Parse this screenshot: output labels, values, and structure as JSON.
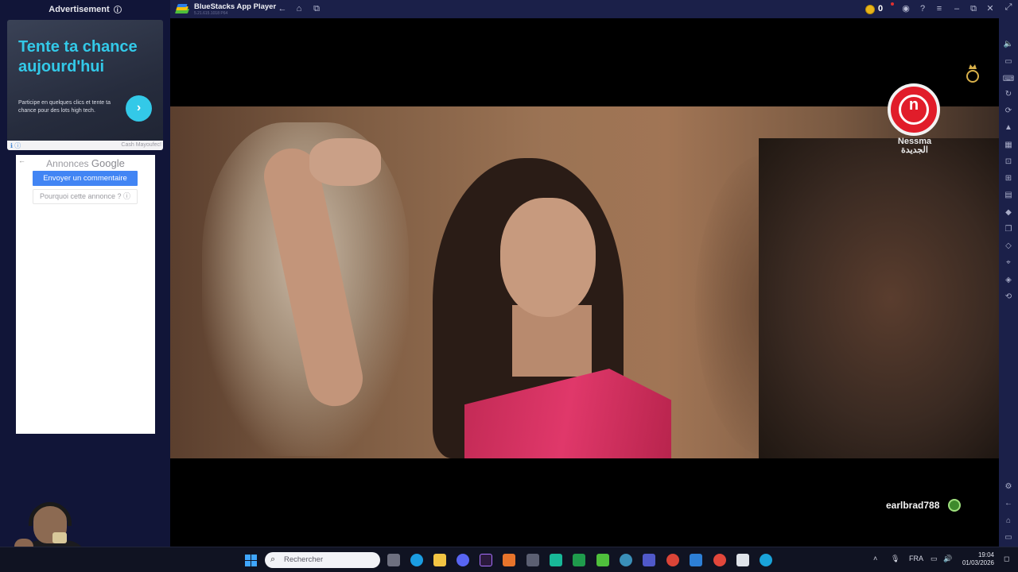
{
  "sidebar": {
    "ad_header": "Advertisement",
    "ad": {
      "title": "Tente ta chance aujourd'hui",
      "text": "Participe en quelques clics et tente ta chance pour des lots high tech.",
      "cta_icon": "›",
      "brand": "Cash Mayoufec!"
    },
    "google": {
      "annonces": "Annonces",
      "google_word": "Google",
      "feedback_button": "Envoyer un commentaire",
      "why_button": "Pourquoi cette annonce ?"
    }
  },
  "window": {
    "title": "BlueStacks App Player",
    "version": "5.21.615.1018 P64",
    "coins": "0",
    "icons": [
      "back-icon",
      "home-icon",
      "multi-instance-icon",
      "help-icon",
      "account-icon",
      "menu-icon",
      "minimize-icon",
      "restore-icon",
      "close-icon"
    ]
  },
  "video": {
    "channel_name": "Nessma الجديدة",
    "username": "earlbrad788"
  },
  "rightbar_icons": [
    "fullscreen-icon",
    "volume-icon",
    "media-icon",
    "keyboard-icon",
    "rotate-icon",
    "sync-icon",
    "macro-icon",
    "gamepad-icon",
    "screenshot-icon",
    "camera-icon",
    "folder-icon",
    "apk-icon",
    "eco-icon",
    "location-icon",
    "layers-icon",
    "refresh-icon",
    "settings-icon",
    "back-icon",
    "home-icon",
    "recents-icon"
  ],
  "taskbar": {
    "search_placeholder": "Rechercher",
    "language": "FRA",
    "time": "19:04",
    "date": "01/03/2026"
  }
}
